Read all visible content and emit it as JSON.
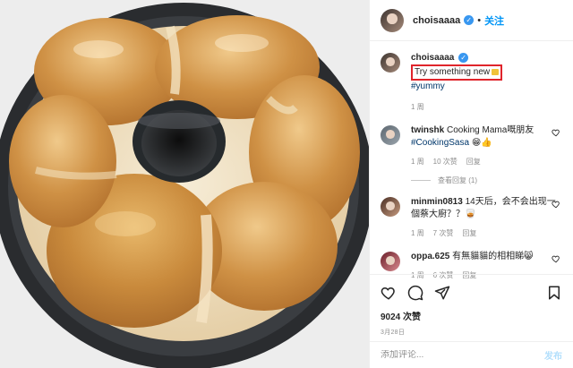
{
  "post": {
    "author": "choisaaaa",
    "follow_label": "关注",
    "icons": [
      "verified-badge-icon",
      "heart-icon",
      "comment-icon",
      "share-icon",
      "save-icon"
    ]
  },
  "caption": {
    "username": "choisaaaa",
    "text": "Try something new",
    "hashtag": "#yummy",
    "time": "1 周"
  },
  "comments": [
    {
      "username": "twinshk",
      "text": "Cooking Mama嘅朋友",
      "hashtag": "#CookingSasa",
      "emoji": "😁👍",
      "time": "1 周",
      "likes": "10 次赞",
      "reply": "回复"
    },
    {
      "username": "minmin0813",
      "text": "14天后，会不会出现一個蔡大廚？？🥃",
      "time": "1 周",
      "likes": "7 次赞",
      "reply": "回复"
    },
    {
      "username": "oppa.625",
      "text": "有無貓貓的相相睇😸",
      "time": "1 周",
      "likes": "6 次赞",
      "reply": "回复"
    }
  ],
  "view_replies": "查看回复 (1)",
  "stats": {
    "likes": "9024 次赞",
    "date": "3月28日"
  },
  "add_comment": {
    "placeholder": "添加评论...",
    "post_label": "发布"
  },
  "colors": {
    "accent": "#0095f6",
    "highlight_border": "#e0242b",
    "muted": "#8e8e8e"
  }
}
